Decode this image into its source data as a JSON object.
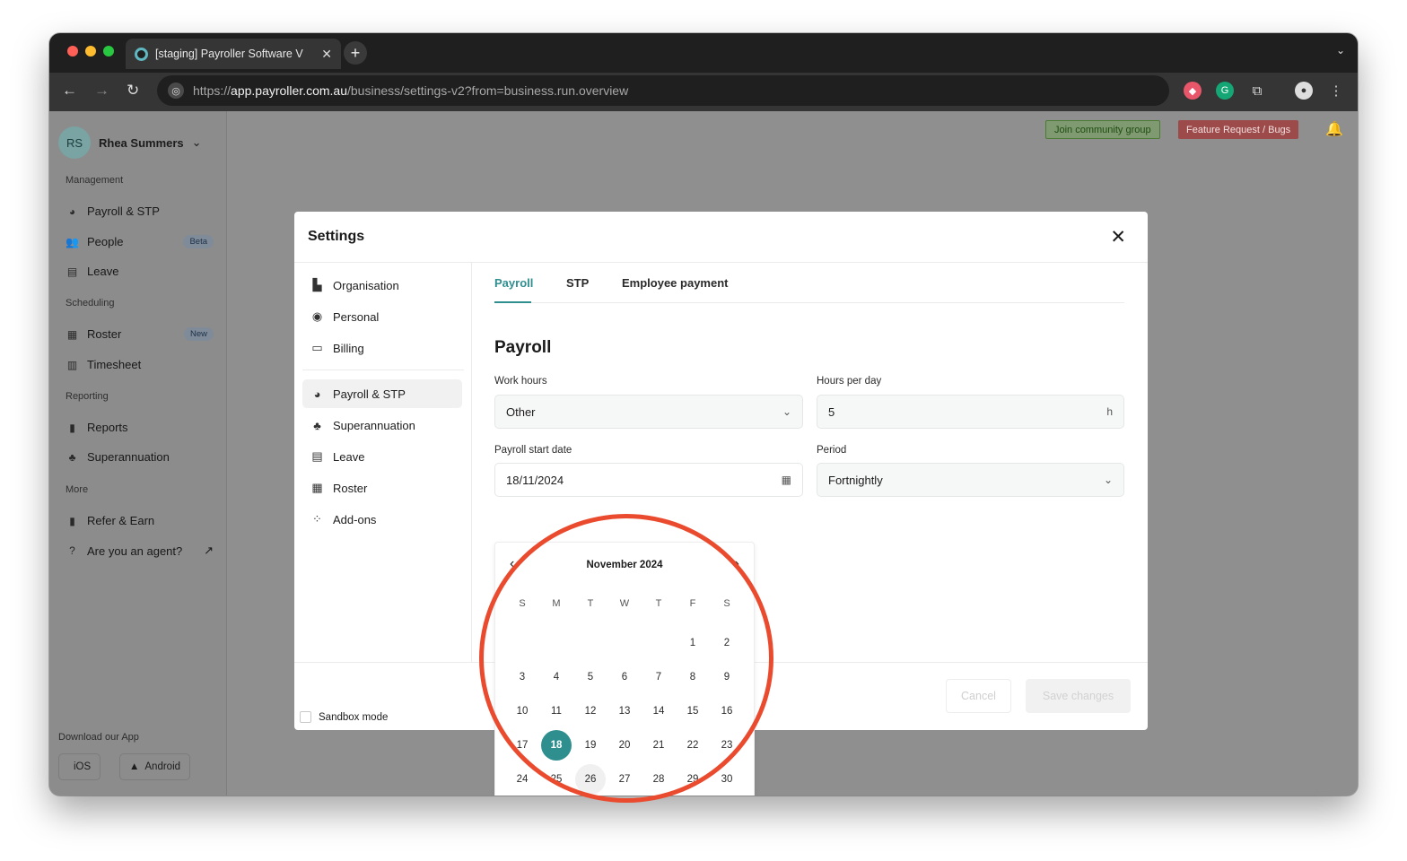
{
  "browser": {
    "tab_title": "[staging] Payroller Software V",
    "url_prefix": "https://",
    "url_domain": "app.payroller.com.au",
    "url_path": "/business/settings-v2?from=business.run.overview"
  },
  "sidebar": {
    "user_initials": "RS",
    "user_name": "Rhea Summers",
    "sections": {
      "management": "Management",
      "scheduling": "Scheduling",
      "reporting": "Reporting",
      "more": "More"
    },
    "items": {
      "payroll": "Payroll & STP",
      "people": "People",
      "people_badge": "Beta",
      "leave": "Leave",
      "roster": "Roster",
      "roster_badge": "New",
      "timesheet": "Timesheet",
      "reports": "Reports",
      "superannuation": "Superannuation",
      "refer": "Refer & Earn",
      "agent": "Are you an agent?"
    },
    "download_label": "Download our App",
    "ios": "iOS",
    "android": "Android"
  },
  "top_buttons": {
    "community": "Join community group",
    "feature": "Feature Request / Bugs"
  },
  "modal": {
    "title": "Settings",
    "nav": {
      "organisation": "Organisation",
      "personal": "Personal",
      "billing": "Billing",
      "payroll": "Payroll & STP",
      "superannuation": "Superannuation",
      "leave": "Leave",
      "roster": "Roster",
      "addons": "Add-ons"
    },
    "sandbox_label": "Sandbox mode",
    "tabs": {
      "payroll": "Payroll",
      "stp": "STP",
      "employee_payment": "Employee payment"
    },
    "section_title": "Payroll",
    "work_hours_label": "Work hours",
    "work_hours_value": "Other",
    "hours_per_day_label": "Hours per day",
    "hours_per_day_value": "5",
    "hours_unit": "h",
    "start_date_label": "Payroll start date",
    "start_date_value": "18/11/2024",
    "period_label": "Period",
    "period_value": "Fortnightly",
    "cancel": "Cancel",
    "save": "Save changes"
  },
  "calendar": {
    "month": "November 2024",
    "weekdays": [
      "S",
      "M",
      "T",
      "W",
      "T",
      "F",
      "S"
    ],
    "selected_day": 18,
    "today_day": 26,
    "weeks": [
      [
        "",
        "",
        "",
        "",
        "",
        "1",
        "2"
      ],
      [
        "3",
        "4",
        "5",
        "6",
        "7",
        "8",
        "9"
      ],
      [
        "10",
        "11",
        "12",
        "13",
        "14",
        "15",
        "16"
      ],
      [
        "17",
        "18",
        "19",
        "20",
        "21",
        "22",
        "23"
      ],
      [
        "24",
        "25",
        "26",
        "27",
        "28",
        "29",
        "30"
      ]
    ]
  },
  "colors": {
    "accent": "#2f8f8f",
    "highlight_ring": "#ea4b2e"
  }
}
